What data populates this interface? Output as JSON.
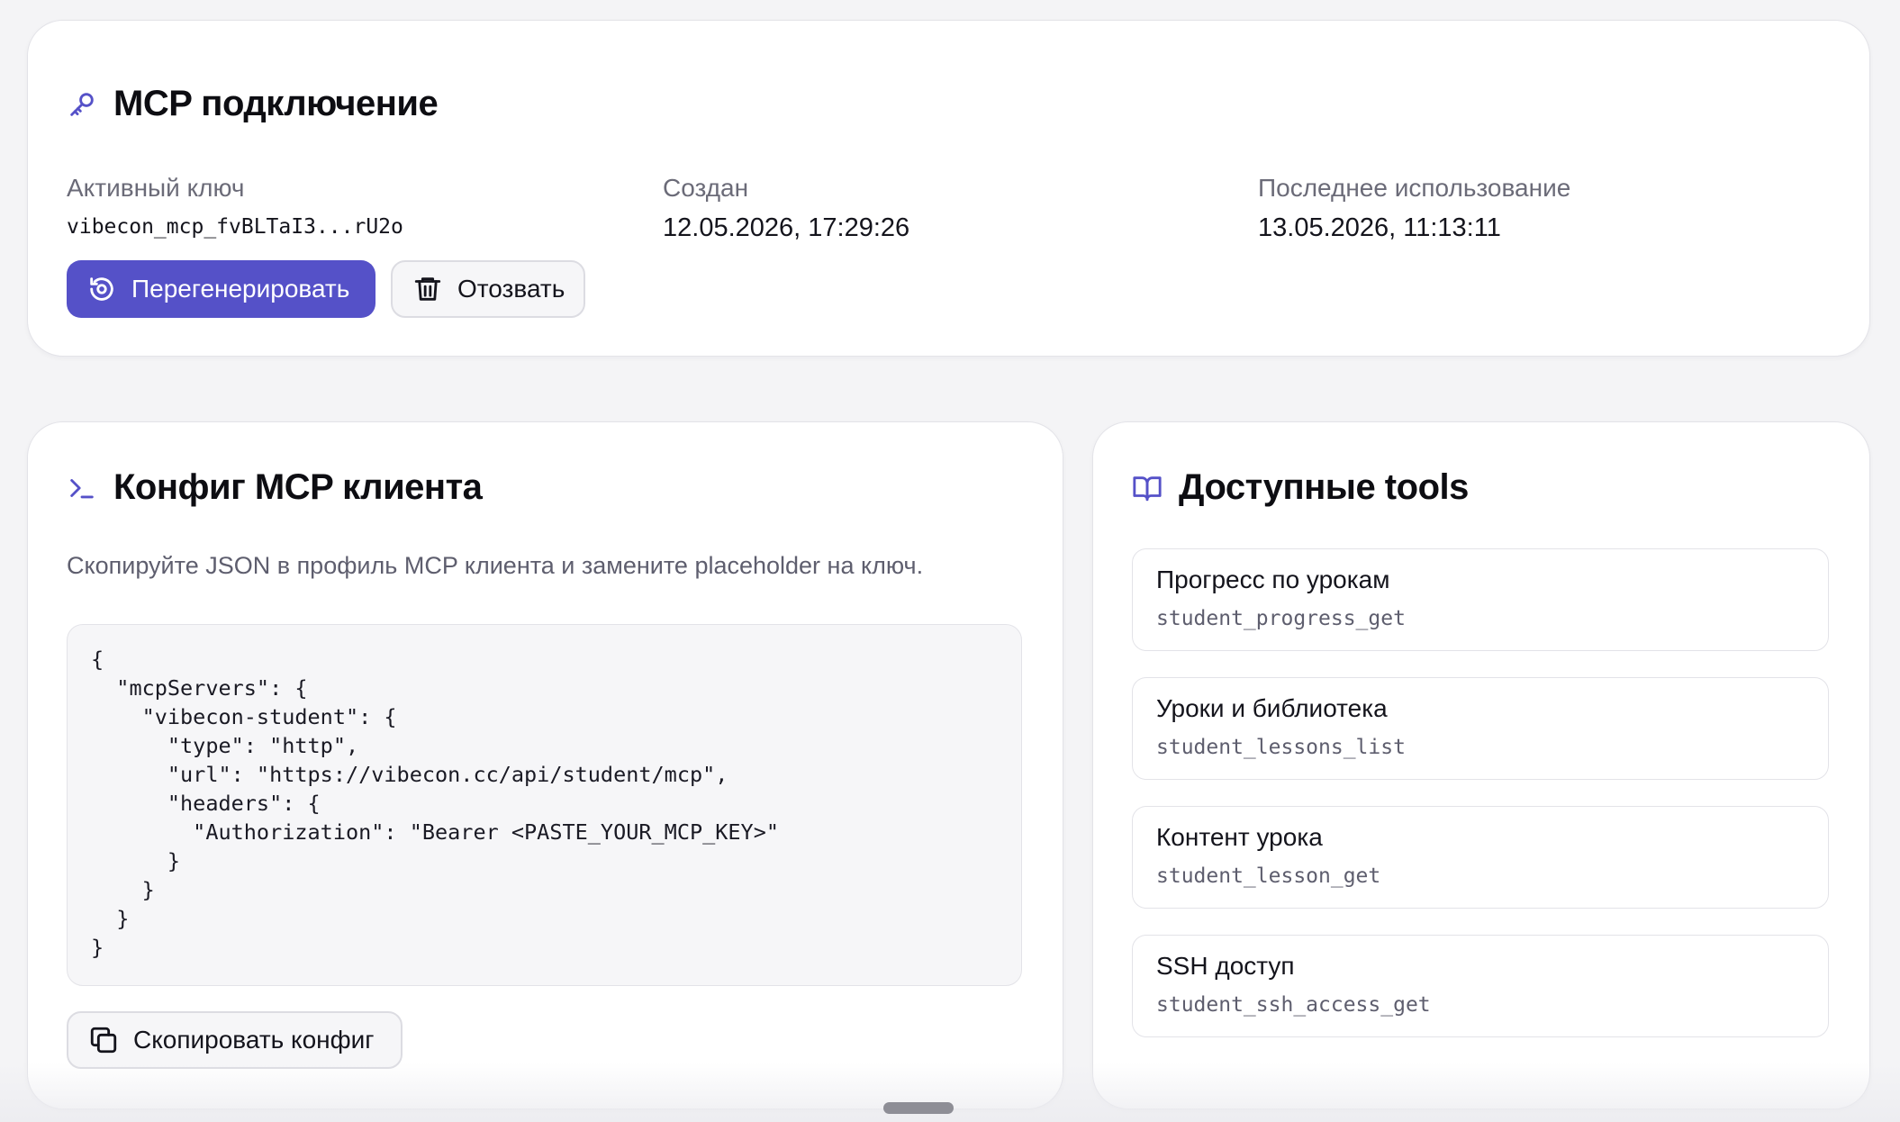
{
  "connection": {
    "title": "MCP подключение",
    "active_key_label": "Активный ключ",
    "active_key_value": "vibecon_mcp_fvBLTaI3...rU2o",
    "created_label": "Создан",
    "created_value": "12.05.2026, 17:29:26",
    "last_used_label": "Последнее использование",
    "last_used_value": "13.05.2026, 11:13:11",
    "regenerate_label": "Перегенерировать",
    "revoke_label": "Отозвать"
  },
  "config": {
    "title": "Конфиг MCP клиента",
    "description": "Скопируйте JSON в профиль MCP клиента и замените placeholder на ключ.",
    "code": "{\n  \"mcpServers\": {\n    \"vibecon-student\": {\n      \"type\": \"http\",\n      \"url\": \"https://vibecon.cc/api/student/mcp\",\n      \"headers\": {\n        \"Authorization\": \"Bearer <PASTE_YOUR_MCP_KEY>\"\n      }\n    }\n  }\n}",
    "copy_label": "Скопировать конфиг"
  },
  "tools": {
    "title": "Доступные tools",
    "items": [
      {
        "name": "Прогресс по урокам",
        "id": "student_progress_get"
      },
      {
        "name": "Уроки и библиотека",
        "id": "student_lessons_list"
      },
      {
        "name": "Контент урока",
        "id": "student_lesson_get"
      },
      {
        "name": "SSH доступ",
        "id": "student_ssh_access_get"
      }
    ]
  },
  "icons": {
    "connection": "key-icon",
    "regenerate": "refresh-icon",
    "revoke": "trash-icon",
    "config": "terminal-icon",
    "copy": "copy-icon",
    "tools": "book-icon"
  },
  "colors": {
    "accent": "#5551c8",
    "background": "#f4f4f6"
  }
}
